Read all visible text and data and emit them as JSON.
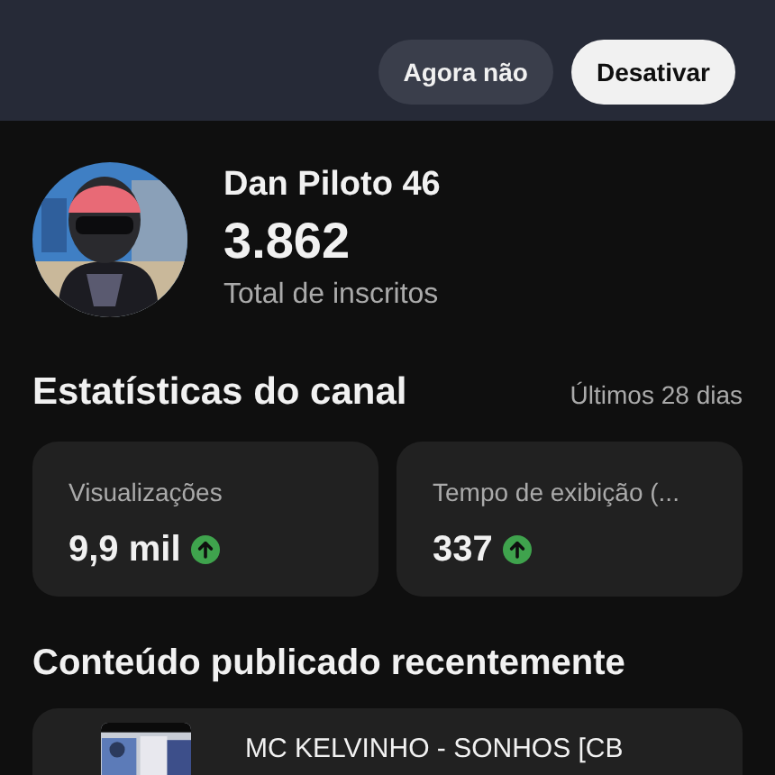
{
  "banner": {
    "buttons": [
      {
        "label": "Agora não",
        "kind": "secondary"
      },
      {
        "label": "Desativar",
        "kind": "primary"
      }
    ]
  },
  "channel": {
    "name": "Dan Piloto 46",
    "subscribers": "3.862",
    "subscribers_label": "Total de inscritos"
  },
  "stats": {
    "title": "Estatísticas do canal",
    "period": "Últimos 28 dias",
    "cards": [
      {
        "label": "Visualizações",
        "value": "9,9 mil",
        "rising": true
      },
      {
        "label": "Tempo de exibição (...",
        "value": "337",
        "rising": true
      }
    ]
  },
  "recent": {
    "title": "Conteúdo publicado recentemente",
    "items": [
      {
        "title": "MC KELVINHO - SONHOS [CB"
      }
    ]
  }
}
